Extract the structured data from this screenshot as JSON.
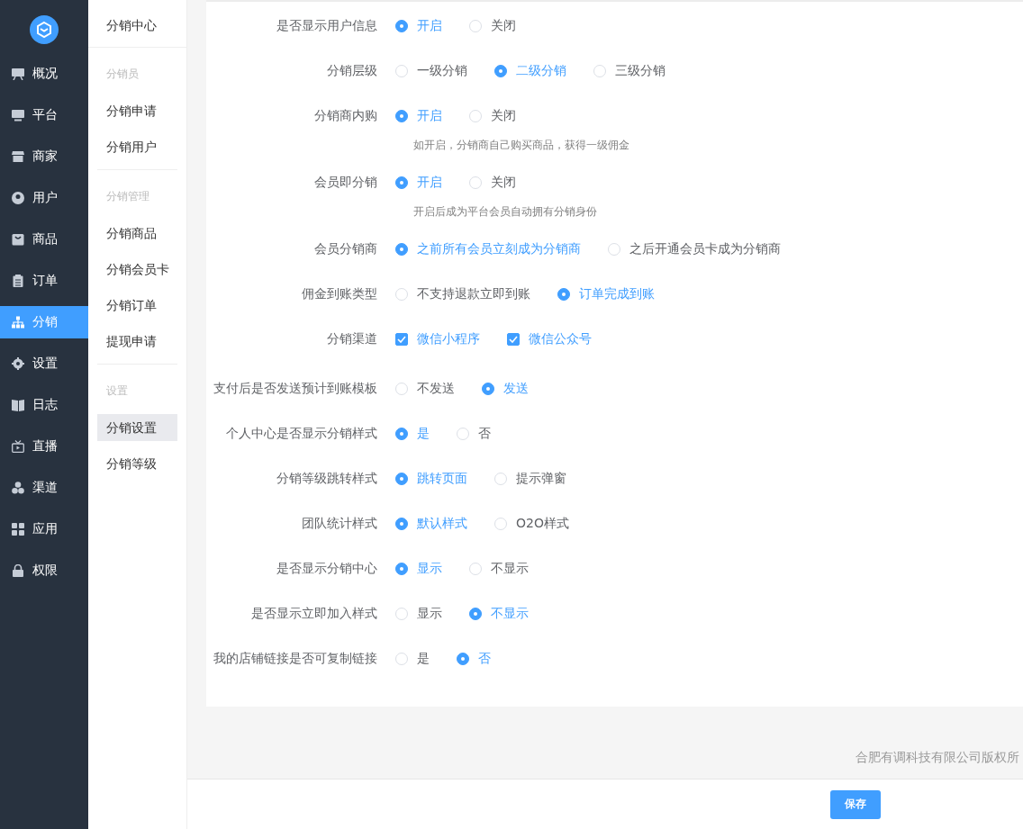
{
  "nav": [
    {
      "label": "概况",
      "selected": false
    },
    {
      "label": "平台",
      "selected": false
    },
    {
      "label": "商家",
      "selected": false
    },
    {
      "label": "用户",
      "selected": false
    },
    {
      "label": "商品",
      "selected": false
    },
    {
      "label": "订单",
      "selected": false
    },
    {
      "label": "分销",
      "selected": true
    },
    {
      "label": "设置",
      "selected": false
    },
    {
      "label": "日志",
      "selected": false
    },
    {
      "label": "直播",
      "selected": false
    },
    {
      "label": "渠道",
      "selected": false
    },
    {
      "label": "应用",
      "selected": false
    },
    {
      "label": "权限",
      "selected": false
    }
  ],
  "submenu": {
    "title": "分销中心",
    "groups": [
      {
        "title": "分销员",
        "items": [
          {
            "label": "分销申请",
            "selected": false
          },
          {
            "label": "分销用户",
            "selected": false
          }
        ]
      },
      {
        "title": "分销管理",
        "items": [
          {
            "label": "分销商品",
            "selected": false
          },
          {
            "label": "分销会员卡",
            "selected": false
          },
          {
            "label": "分销订单",
            "selected": false
          },
          {
            "label": "提现申请",
            "selected": false
          }
        ]
      },
      {
        "title": "设置",
        "items": [
          {
            "label": "分销设置",
            "selected": true
          },
          {
            "label": "分销等级",
            "selected": false
          }
        ]
      }
    ]
  },
  "form": [
    {
      "label": "是否显示用户信息",
      "kind": "radio",
      "options": [
        {
          "label": "开启",
          "selected": true
        },
        {
          "label": "关闭",
          "selected": false
        }
      ]
    },
    {
      "label": "分销层级",
      "kind": "radio",
      "options": [
        {
          "label": "一级分销",
          "selected": false
        },
        {
          "label": "二级分销",
          "selected": true
        },
        {
          "label": "三级分销",
          "selected": false
        }
      ]
    },
    {
      "label": "分销商内购",
      "kind": "radio",
      "options": [
        {
          "label": "开启",
          "selected": true
        },
        {
          "label": "关闭",
          "selected": false
        }
      ],
      "hint": "如开启，分销商自己购买商品，获得一级佣金"
    },
    {
      "label": "会员即分销",
      "kind": "radio",
      "options": [
        {
          "label": "开启",
          "selected": true
        },
        {
          "label": "关闭",
          "selected": false
        }
      ],
      "hint": "开启后成为平台会员自动拥有分销身份"
    },
    {
      "label": "会员分销商",
      "kind": "radio",
      "options": [
        {
          "label": "之前所有会员立刻成为分销商",
          "selected": true
        },
        {
          "label": "之后开通会员卡成为分销商",
          "selected": false
        }
      ]
    },
    {
      "label": "佣金到账类型",
      "kind": "radio",
      "options": [
        {
          "label": "不支持退款立即到账",
          "selected": false
        },
        {
          "label": "订单完成到账",
          "selected": true
        }
      ]
    },
    {
      "label": "分销渠道",
      "kind": "checkbox",
      "options": [
        {
          "label": "微信小程序",
          "checked": true
        },
        {
          "label": "微信公众号",
          "checked": true
        }
      ]
    },
    {
      "label": "支付后是否发送预计到账模板",
      "kind": "radio",
      "options": [
        {
          "label": "不发送",
          "selected": false
        },
        {
          "label": "发送",
          "selected": true
        }
      ]
    },
    {
      "label": "个人中心是否显示分销样式",
      "kind": "radio",
      "options": [
        {
          "label": "是",
          "selected": true
        },
        {
          "label": "否",
          "selected": false
        }
      ]
    },
    {
      "label": "分销等级跳转样式",
      "kind": "radio",
      "options": [
        {
          "label": "跳转页面",
          "selected": true
        },
        {
          "label": "提示弹窗",
          "selected": false
        }
      ]
    },
    {
      "label": "团队统计样式",
      "kind": "radio",
      "options": [
        {
          "label": "默认样式",
          "selected": true
        },
        {
          "label": "O2O样式",
          "selected": false
        }
      ]
    },
    {
      "label": "是否显示分销中心",
      "kind": "radio",
      "options": [
        {
          "label": "显示",
          "selected": true
        },
        {
          "label": "不显示",
          "selected": false
        }
      ]
    },
    {
      "label": "是否显示立即加入样式",
      "kind": "radio",
      "options": [
        {
          "label": "显示",
          "selected": false
        },
        {
          "label": "不显示",
          "selected": true
        }
      ]
    },
    {
      "label": "我的店铺链接是否可复制链接",
      "kind": "radio",
      "options": [
        {
          "label": "是",
          "selected": false
        },
        {
          "label": "否",
          "selected": true
        }
      ]
    }
  ],
  "copyright": "合肥有调科技有限公司版权所",
  "save_button": "保存"
}
